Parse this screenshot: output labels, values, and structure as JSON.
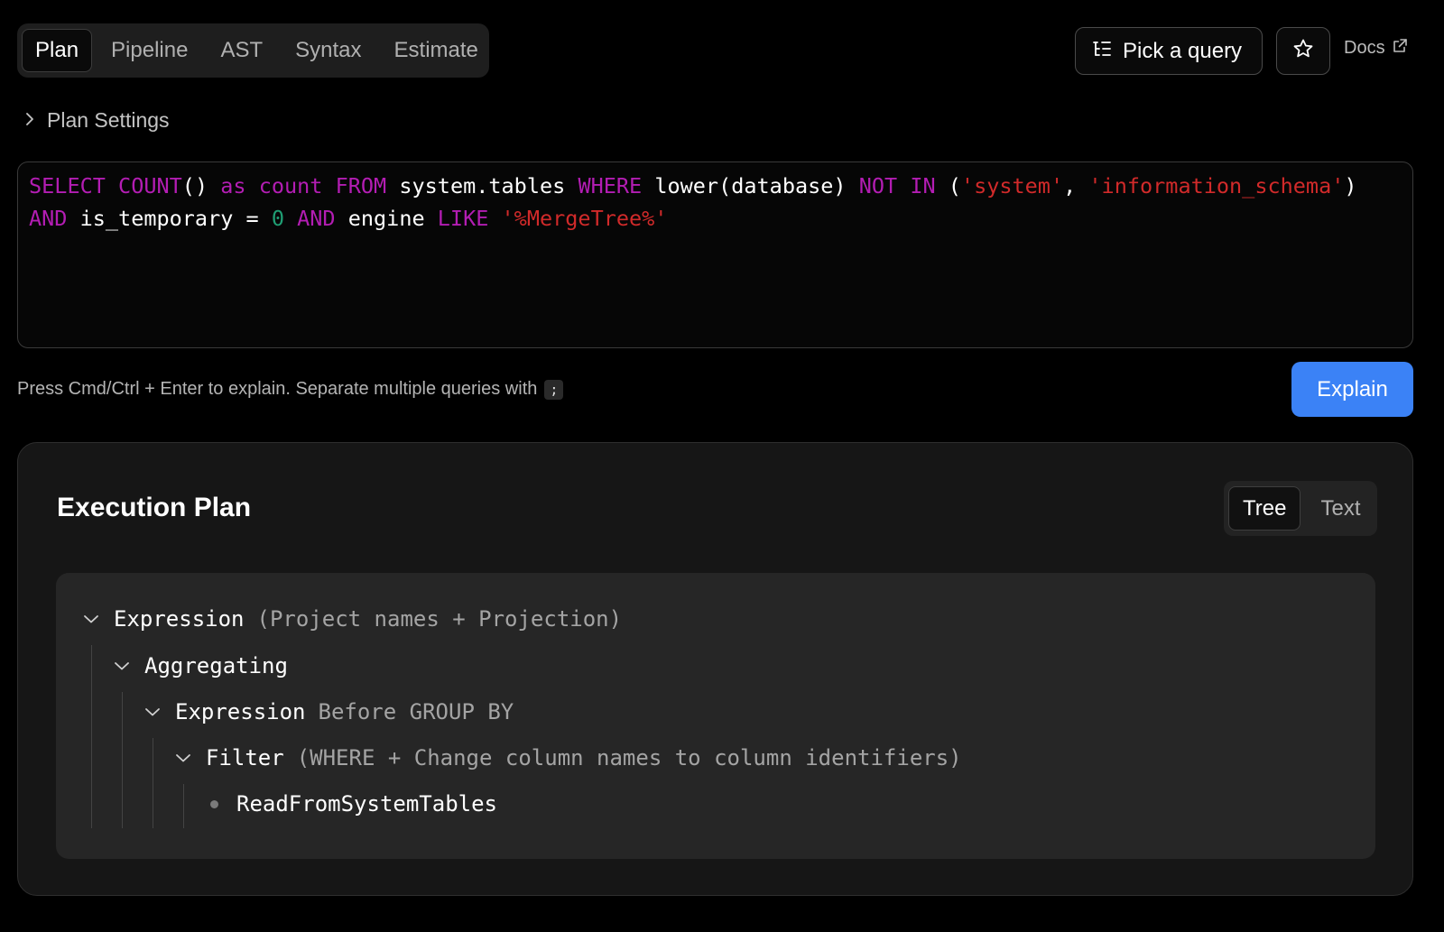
{
  "tabs": [
    {
      "label": "Plan",
      "active": true
    },
    {
      "label": "Pipeline",
      "active": false
    },
    {
      "label": "AST",
      "active": false
    },
    {
      "label": "Syntax",
      "active": false
    },
    {
      "label": "Estimate",
      "active": false
    }
  ],
  "header": {
    "pick_query_label": "Pick a query",
    "pick_query_icon": "list-tree-icon",
    "star_icon": "star-icon",
    "docs_label": "Docs",
    "docs_icon": "external-link-icon"
  },
  "plan_settings": {
    "label": "Plan Settings",
    "icon": "chevron-right-icon"
  },
  "editor": {
    "query": "SELECT COUNT() as count FROM system.tables WHERE lower(database) NOT IN ('system', 'information_schema') AND is_temporary = 0 AND engine LIKE '%MergeTree%'",
    "tokens": {
      "line1": [
        "SELECT",
        " ",
        "COUNT",
        "()",
        " ",
        "as",
        " ",
        "count",
        " ",
        "FROM",
        " system.tables ",
        "WHERE",
        " lower(database) ",
        "NOT",
        " ",
        "IN",
        " (",
        "'system'",
        ", ",
        "'information_schema'",
        ")"
      ],
      "line2": [
        "AND",
        " is_temporary = ",
        "0",
        " ",
        "AND",
        " engine ",
        "LIKE",
        " ",
        "'%MergeTree%'"
      ]
    }
  },
  "hint": {
    "text": "Press Cmd/Ctrl + Enter to explain. Separate multiple queries with",
    "key": ";"
  },
  "explain_button": "Explain",
  "execution_plan": {
    "title": "Execution Plan",
    "views": [
      {
        "label": "Tree",
        "active": true
      },
      {
        "label": "Text",
        "active": false
      }
    ],
    "nodes": [
      {
        "name": "Expression",
        "detail": "(Project names + Projection)",
        "expanded": true
      },
      {
        "name": "Aggregating",
        "detail": "",
        "expanded": true
      },
      {
        "name": "Expression",
        "detail": "Before GROUP BY",
        "expanded": true
      },
      {
        "name": "Filter",
        "detail": "(WHERE + Change column names to column identifiers)",
        "expanded": true
      },
      {
        "name": "ReadFromSystemTables",
        "detail": "",
        "leaf": true
      }
    ]
  },
  "colors": {
    "keyword": "#b31db3",
    "string": "#d12a2a",
    "number": "#1f9e73",
    "accent": "#3b82f6"
  }
}
